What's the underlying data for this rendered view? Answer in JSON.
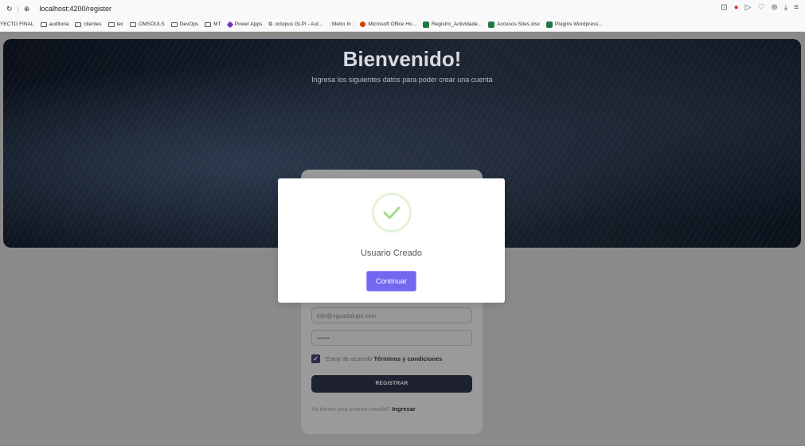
{
  "browser": {
    "url": "localhost:4200/register",
    "bookmarks": [
      {
        "label": "YECTO FINAL",
        "icon": "none"
      },
      {
        "label": "auditoria",
        "icon": "folder-icon"
      },
      {
        "label": "clientes",
        "icon": "folder-icon"
      },
      {
        "label": "tec",
        "icon": "folder-icon"
      },
      {
        "label": "OMSOULS",
        "icon": "folder-icon"
      },
      {
        "label": "DevOps",
        "icon": "folder-icon"
      },
      {
        "label": "MT",
        "icon": "folder-icon"
      },
      {
        "label": "Power Apps",
        "icon": "powerapps-icon"
      },
      {
        "label": "octopus GLPI - Aut...",
        "icon": "glpi-icon"
      },
      {
        "label": ": Metro In :",
        "icon": "metro-icon"
      },
      {
        "label": "Microsoft Office Ho...",
        "icon": "office-icon"
      },
      {
        "label": "Registro_Actividade...",
        "icon": "excel-icon"
      },
      {
        "label": "Accesos Sites.xlsx",
        "icon": "excel-icon"
      },
      {
        "label": "Plugins Wordpress...",
        "icon": "excel-icon"
      }
    ]
  },
  "hero": {
    "title": "Bienvenido!",
    "subtitle": "Ingresa los siguientes datos para poder crear una cuenta"
  },
  "form": {
    "email_value": "info@vguadalupe.com",
    "password_value": "••••••",
    "terms_prefix": "Estoy de acuerdo",
    "terms_link": "Términos y condiciones",
    "register_label": "REGISTRAR",
    "login_prefix": "Ya tienes una cuenta creada?",
    "login_link": "Ingresar"
  },
  "modal": {
    "title": "Usuario Creado",
    "button_label": "Continuar",
    "icon": "success-check-icon"
  },
  "colors": {
    "accent": "#7367f0",
    "success": "#a5dc86"
  }
}
